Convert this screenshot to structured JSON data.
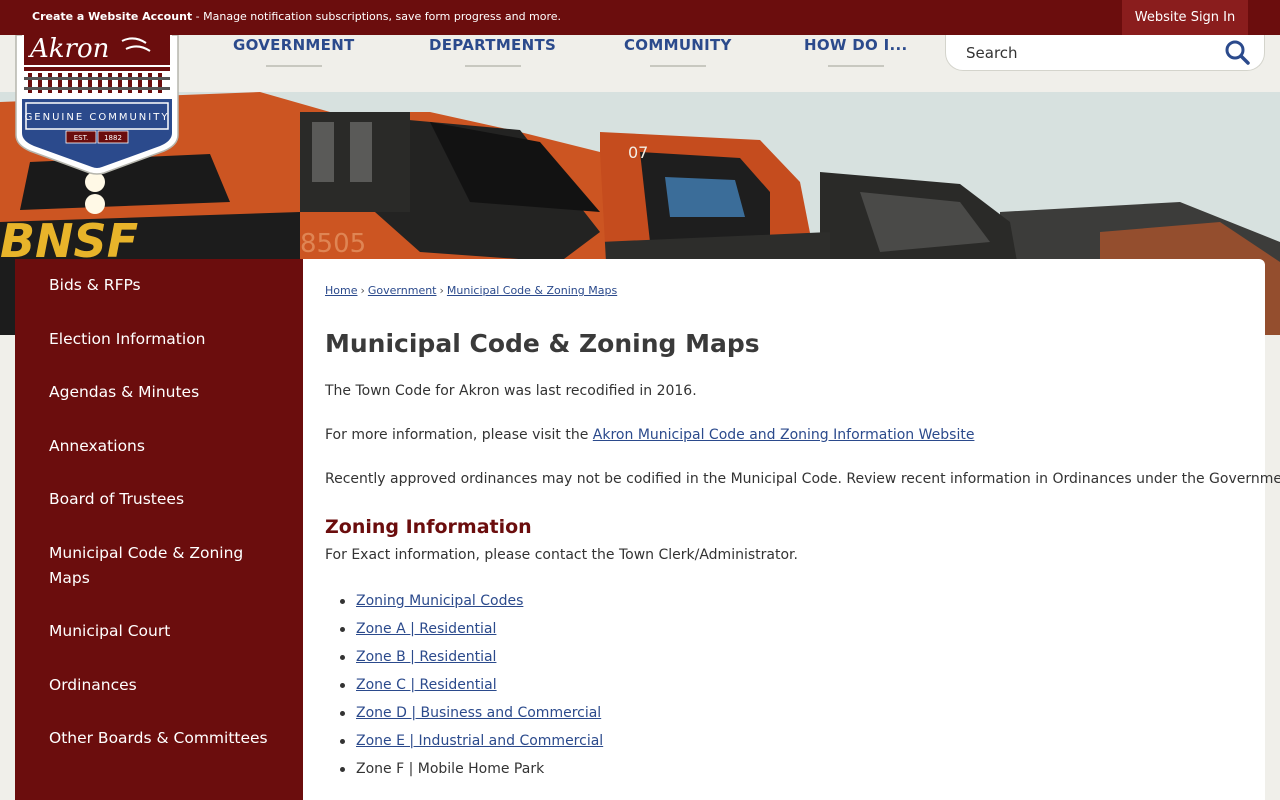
{
  "topbar": {
    "create_account": "Create a Website Account",
    "message": " - Manage notification subscriptions, save form progress and more.",
    "signin": "Website Sign In"
  },
  "nav": {
    "items": [
      {
        "label": "GOVERNMENT"
      },
      {
        "label": "DEPARTMENTS"
      },
      {
        "label": "COMMUNITY"
      },
      {
        "label": "HOW DO I..."
      }
    ]
  },
  "search": {
    "placeholder": "Search",
    "icon": "search-icon"
  },
  "logo": {
    "town": "Akron",
    "tagline": "GENUINE COMMUNITY",
    "est": "EST.",
    "year": "1882"
  },
  "hero": {
    "loco_number_1": "8505",
    "loco_number_2": "07",
    "railroad": "BNSF"
  },
  "sidebar": {
    "items": [
      {
        "label": "Bids & RFPs"
      },
      {
        "label": "Election Information"
      },
      {
        "label": "Agendas & Minutes"
      },
      {
        "label": "Annexations"
      },
      {
        "label": "Board of Trustees"
      },
      {
        "label": "Municipal Code & Zoning Maps"
      },
      {
        "label": "Municipal Court"
      },
      {
        "label": "Ordinances"
      },
      {
        "label": "Other Boards & Committees"
      }
    ]
  },
  "breadcrumb": {
    "items": [
      "Home",
      "Government",
      "Municipal Code & Zoning Maps"
    ],
    "separator": "›"
  },
  "main": {
    "title": "Municipal Code & Zoning Maps",
    "p1": "The Town Code for Akron was last recodified in 2016.",
    "p2_prefix": "For more information, please visit the ",
    "p2_link": "Akron Municipal Code and Zoning Information Website",
    "p3": "Recently approved ordinances may not be codified in the Municipal Code. Review recent information in Ordinances under the Government tab.",
    "zoning_heading": "Zoning Information",
    "zoning_intro": "For Exact information, please contact the Town Clerk/Administrator.",
    "zoning_links": [
      "Zoning Municipal Codes",
      "Zone A | Residential",
      "Zone B | Residential",
      "Zone C | Residential",
      "Zone D | Business and Commercial",
      "Zone E | Industrial and Commercial"
    ],
    "zoning_plain": "Zone F | Mobile Home Park"
  },
  "colors": {
    "brand": "#6b0d0d",
    "link": "#2b4a8c",
    "nav": "#2b4a8c"
  }
}
